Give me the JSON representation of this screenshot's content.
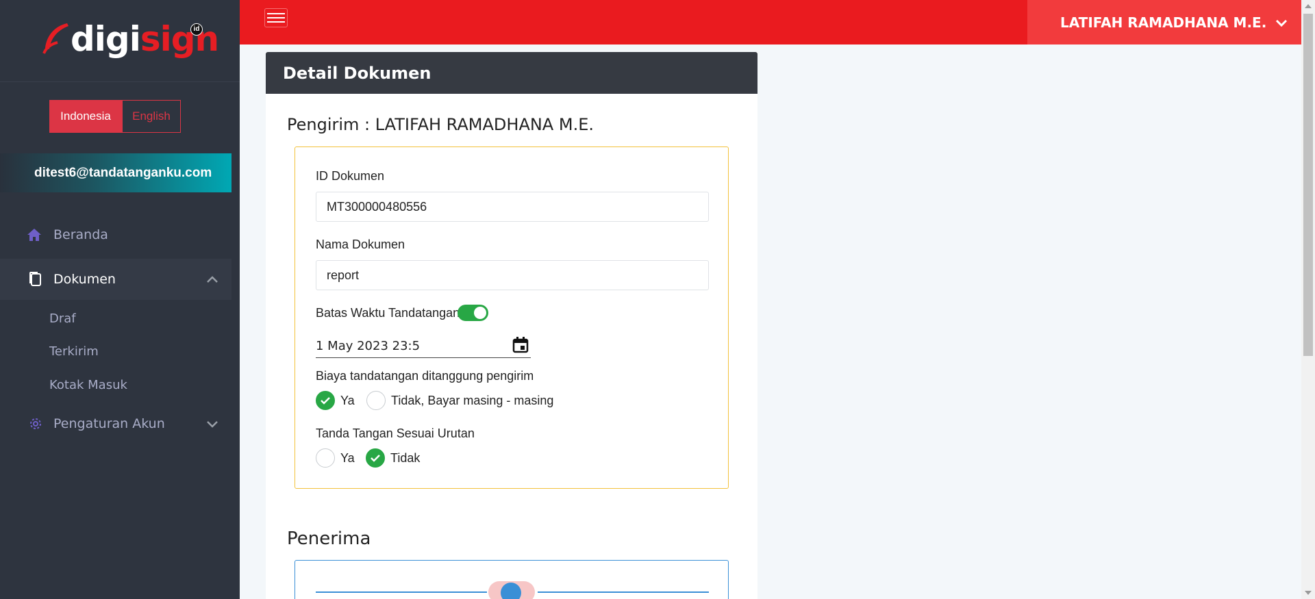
{
  "brand": {
    "digi": "digi",
    "sign": "sign",
    "badge": "id"
  },
  "language": {
    "active": "Indonesia",
    "inactive": "English"
  },
  "user": {
    "email": "ditest6@tandatanganku.com",
    "name": "LATIFAH RAMADHANA M.E."
  },
  "nav": {
    "home": "Beranda",
    "documents": "Dokumen",
    "sub": [
      "Draf",
      "Terkirim",
      "Kotak Masuk"
    ],
    "account": "Pengaturan Akun"
  },
  "card": {
    "title": "Detail Dokumen",
    "sender": "Pengirim : LATIFAH RAMADHANA M.E.",
    "doc_id_label": "ID Dokumen",
    "doc_id": "MT300000480556",
    "doc_name_label": "Nama Dokumen",
    "doc_name": "report",
    "deadline_label": "Batas Waktu Tandatangan",
    "deadline_value": "1 May 2023 23:5",
    "cost_label": "Biaya tandatangan ditanggung pengirim",
    "cost_yes": "Ya",
    "cost_no": "Tidak, Bayar masing - masing",
    "order_label": "Tanda Tangan Sesuai Urutan",
    "order_yes": "Ya",
    "order_no": "Tidak",
    "recipient_title": "Penerima"
  },
  "colors": {
    "header": "#ea1b1f",
    "sidebar": "#2e343f",
    "accent_green": "#28a745",
    "accent_red": "#dc3545",
    "form_border": "#f3c23c",
    "recipient_border": "#3a8fd6"
  },
  "icons": [
    "menu-icon",
    "home-icon",
    "document-icon",
    "gear-icon",
    "chevron-down-icon",
    "chevron-up-icon",
    "calendar-icon",
    "check-icon"
  ]
}
